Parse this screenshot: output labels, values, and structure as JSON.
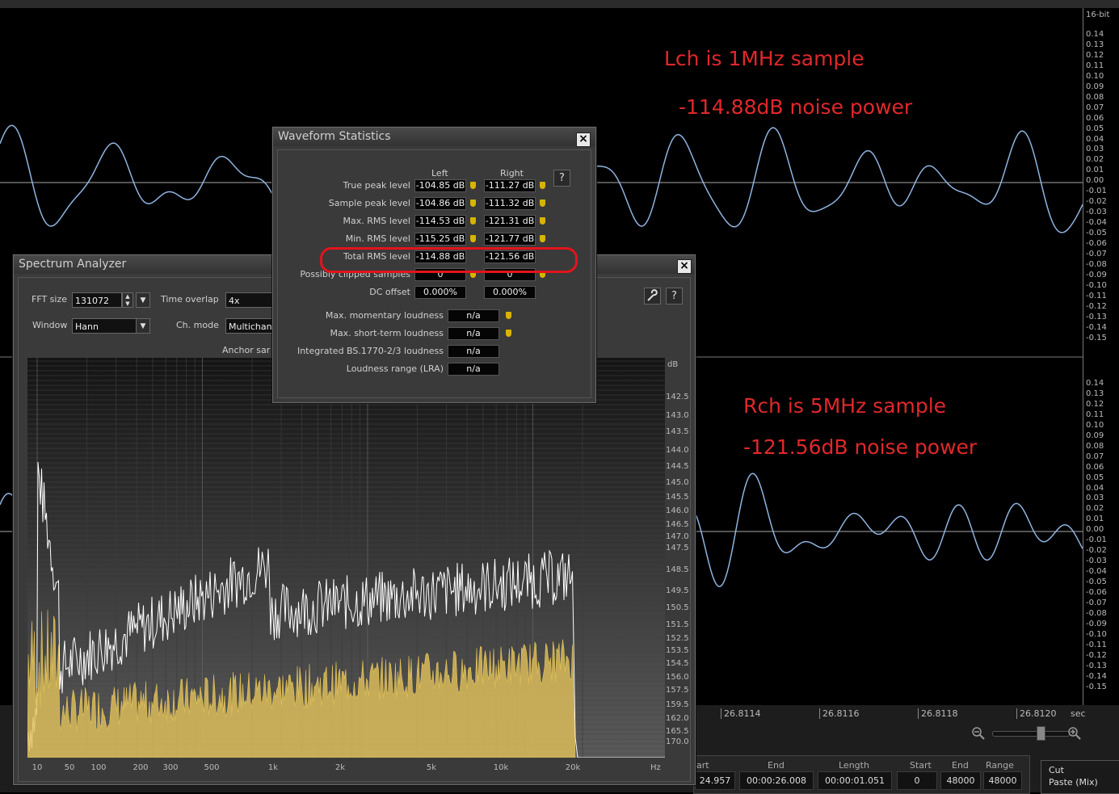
{
  "waveform_view": {
    "bit_depth": "16-bit",
    "amp_ticks_left": [
      "0.14",
      "0.13",
      "0.12",
      "0.11",
      "0.10",
      "0.09",
      "0.08",
      "0.07",
      "0.06",
      "0.05",
      "0.04",
      "0.03",
      "0.02",
      "0.01",
      "0.00",
      "-0.01",
      "-0.02",
      "-0.03",
      "-0.04",
      "-0.05",
      "-0.06",
      "-0.07",
      "-0.08",
      "-0.09",
      "-0.10",
      "-0.11",
      "-0.12",
      "-0.13",
      "-0.14",
      "-0.15"
    ],
    "amp_ticks_right": [
      "0.14",
      "0.13",
      "0.12",
      "0.11",
      "0.10",
      "0.09",
      "0.08",
      "0.07",
      "0.06",
      "0.05",
      "0.04",
      "0.03",
      "0.02",
      "0.01",
      "0.00",
      "-0.01",
      "-0.02",
      "-0.03",
      "-0.04",
      "-0.05",
      "-0.06",
      "-0.07",
      "-0.08",
      "-0.09",
      "-0.10",
      "-0.11",
      "-0.12",
      "-0.13",
      "-0.14",
      "-0.15"
    ],
    "time_ticks": [
      "26.8114",
      "26.8116",
      "26.8118",
      "26.8120"
    ],
    "time_unit": "sec",
    "waveform_color": "#8fb4e0"
  },
  "annotations": {
    "lch_title": "Lch is 1MHz sample",
    "lch_value": "-114.88dB noise power",
    "rch_title": "Rch is 5MHz sample",
    "rch_value": "-121.56dB noise power",
    "color": "#e0282b"
  },
  "selection": {
    "start_header": "art",
    "end_header": "End",
    "length_header": "Length",
    "start_value": "24.957",
    "end_value": "00:00:26.008",
    "length_value": "00:00:01.051",
    "sample_start_header": "Start",
    "sample_end_header": "End",
    "sample_range_header": "Range",
    "sample_start": "0",
    "sample_end": "48000",
    "sample_range": "48000"
  },
  "edit_menu": [
    "Cut",
    "Paste (Mix)"
  ],
  "waveform_stats": {
    "title": "Waveform Statistics",
    "col_left": "Left",
    "col_right": "Right",
    "help": "?",
    "rows": [
      {
        "label": "True peak level",
        "left": "-104.85 dB",
        "right": "-111.27 dB",
        "shield": true
      },
      {
        "label": "Sample peak level",
        "left": "-104.86 dB",
        "right": "-111.32 dB",
        "shield": true
      },
      {
        "label": "Max. RMS level",
        "left": "-114.53 dB",
        "right": "-121.31 dB",
        "shield": true
      },
      {
        "label": "Min. RMS level",
        "left": "-115.25 dB",
        "right": "-121.77 dB",
        "shield": true
      },
      {
        "label": "Total RMS level",
        "left": "-114.88 dB",
        "right": "-121.56 dB",
        "shield": false
      },
      {
        "label": "Possibly clipped samples",
        "left": "0",
        "right": "0",
        "shield": true
      },
      {
        "label": "DC offset",
        "left": "0.000%",
        "right": "0.000%",
        "shield": false
      }
    ],
    "loudness": [
      {
        "label": "Max. momentary loudness",
        "value": "n/a",
        "shield": true
      },
      {
        "label": "Max. short-term loudness",
        "value": "n/a",
        "shield": true
      },
      {
        "label": "Integrated BS.1770-2/3 loudness",
        "value": "n/a",
        "shield": false
      },
      {
        "label": "Loudness range (LRA)",
        "value": "n/a",
        "shield": false
      }
    ]
  },
  "spectrum": {
    "title": "Spectrum Analyzer",
    "fft_label": "FFT size",
    "fft_value": "131072",
    "overlap_label": "Time overlap",
    "overlap_value": "4x",
    "window_label": "Window",
    "window_value": "Hann",
    "chmode_label": "Ch. mode",
    "chmode_value": "Multichan",
    "anchor_label": "Anchor sar",
    "help": "?",
    "db_unit": "dB",
    "db_ticks": [
      "142.5",
      "143.0",
      "143.5",
      "144.0",
      "144.5",
      "145.0",
      "145.5",
      "146.0",
      "146.5",
      "147.0",
      "147.5",
      "148.5",
      "149.5",
      "150.5",
      "151.5",
      "152.5",
      "153.5",
      "154.5",
      "156.0",
      "157.5",
      "159.5",
      "162.0",
      "165.5",
      "170.0"
    ],
    "hz_unit": "Hz",
    "hz_ticks": [
      "10",
      "50",
      "100",
      "200",
      "300",
      "500",
      "1k",
      "2k",
      "5k",
      "10k",
      "20k"
    ],
    "white_series_color": "#ffffff",
    "yellow_series_color": "#e3c35a"
  }
}
